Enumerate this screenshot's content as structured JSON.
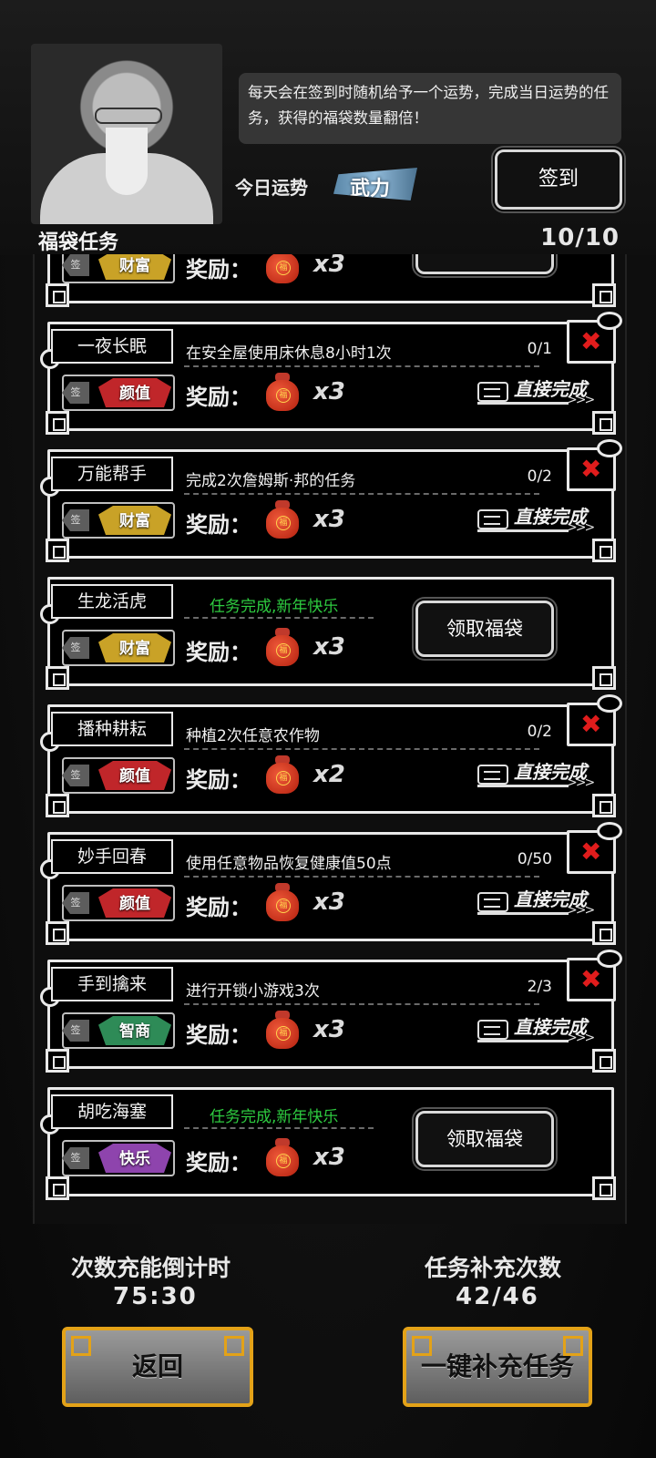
{
  "header": {
    "tip": "每天会在签到时随机给予一个运势，完成当日运势的任务，获得的福袋数量翻倍！",
    "fortune_label": "今日运势",
    "fortune_value": "武力",
    "sign_button": "签到",
    "section_title": "福袋任务",
    "section_count": "10/10"
  },
  "common": {
    "reward_label": "奖励：",
    "seal": "签",
    "quick_complete": "直接完成",
    "chevrons": ">>>",
    "close_mark": "✖",
    "claim_button": "领取福袋"
  },
  "tasks": [
    {
      "name": "",
      "attribute": "财富",
      "multiplier": "x3",
      "status": "claimable",
      "desc": "",
      "progress": ""
    },
    {
      "name": "一夜长眠",
      "desc": "在安全屋使用床休息8小时1次",
      "progress": "0/1",
      "attribute": "颜值",
      "multiplier": "x3",
      "status": "active"
    },
    {
      "name": "万能帮手",
      "desc": "完成2次詹姆斯·邦的任务",
      "progress": "0/2",
      "attribute": "财富",
      "multiplier": "x3",
      "status": "active"
    },
    {
      "name": "生龙活虎",
      "done_text": "任务完成,新年快乐",
      "attribute": "财富",
      "multiplier": "x3",
      "status": "claimable"
    },
    {
      "name": "播种耕耘",
      "desc": "种植2次任意农作物",
      "progress": "0/2",
      "attribute": "颜值",
      "multiplier": "x2",
      "status": "active"
    },
    {
      "name": "妙手回春",
      "desc": "使用任意物品恢复健康值50点",
      "progress": "0/50",
      "attribute": "颜值",
      "multiplier": "x3",
      "status": "active"
    },
    {
      "name": "手到擒来",
      "desc": "进行开锁小游戏3次",
      "progress": "2/3",
      "attribute": "智商",
      "multiplier": "x3",
      "status": "active"
    },
    {
      "name": "胡吃海塞",
      "done_text": "任务完成,新年快乐",
      "attribute": "快乐",
      "multiplier": "x3",
      "status": "claimable"
    }
  ],
  "footer": {
    "countdown_title": "次数充能倒计时",
    "countdown_value": "75:30",
    "refill_title": "任务补充次数",
    "refill_value": "42/46",
    "back_button": "返回",
    "refill_button": "一键补充任务"
  },
  "colors": {
    "done_green": "#2ecc40",
    "close_red": "#e01c1c",
    "gold_border": "#e3a218",
    "attr_wealth": "#c9a227",
    "attr_looks": "#c0262a",
    "attr_iq": "#2e8b57",
    "attr_joy": "#8e44ad"
  }
}
